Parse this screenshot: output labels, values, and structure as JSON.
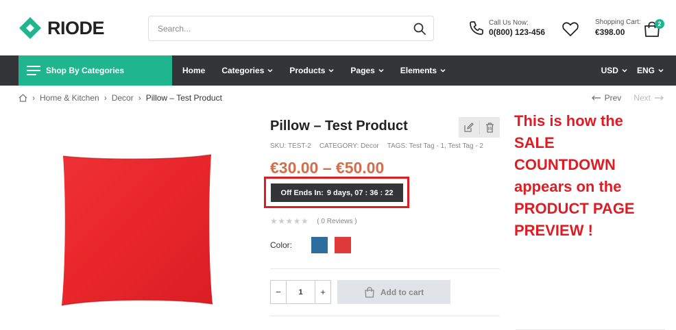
{
  "header": {
    "logo_text": "RIODE",
    "search_placeholder": "Search...",
    "call_label": "Call Us Now:",
    "call_number": "0(800) 123-456",
    "cart_label": "Shopping Cart:",
    "cart_total": "€398.00",
    "cart_count": "2",
    "brand_color": "#1fb58f"
  },
  "nav": {
    "shop_by_categories": "Shop By Categories",
    "items": [
      {
        "label": "Home"
      },
      {
        "label": "Categories"
      },
      {
        "label": "Products"
      },
      {
        "label": "Pages"
      },
      {
        "label": "Elements"
      }
    ],
    "currency": "USD",
    "language": "ENG"
  },
  "breadcrumb": {
    "items": [
      "Home & Kitchen",
      "Decor",
      "Pillow – Test Product"
    ],
    "prev": "Prev",
    "next": "Next"
  },
  "product": {
    "title": "Pillow – Test Product",
    "sku": "SKU: TEST-2",
    "category": "CATEGORY: Decor",
    "tags": "TAGS: Test Tag - 1, Test Tag - 2",
    "price": "€30.00 – €50.00",
    "countdown_label": "Off Ends In:",
    "countdown_value": "9 days, 07 : 36 : 22",
    "rating": 0,
    "reviews": "( 0 Reviews )",
    "color_label": "Color:",
    "swatches": [
      "#2e6e9e",
      "#e03a3a"
    ],
    "quantity": "1",
    "add_to_cart": "Add to cart",
    "image_color": "#e8262b"
  },
  "annotation": {
    "text": "This is how the SALE COUNTDOWN appears on the PRODUCT PAGE PREVIEW !"
  }
}
